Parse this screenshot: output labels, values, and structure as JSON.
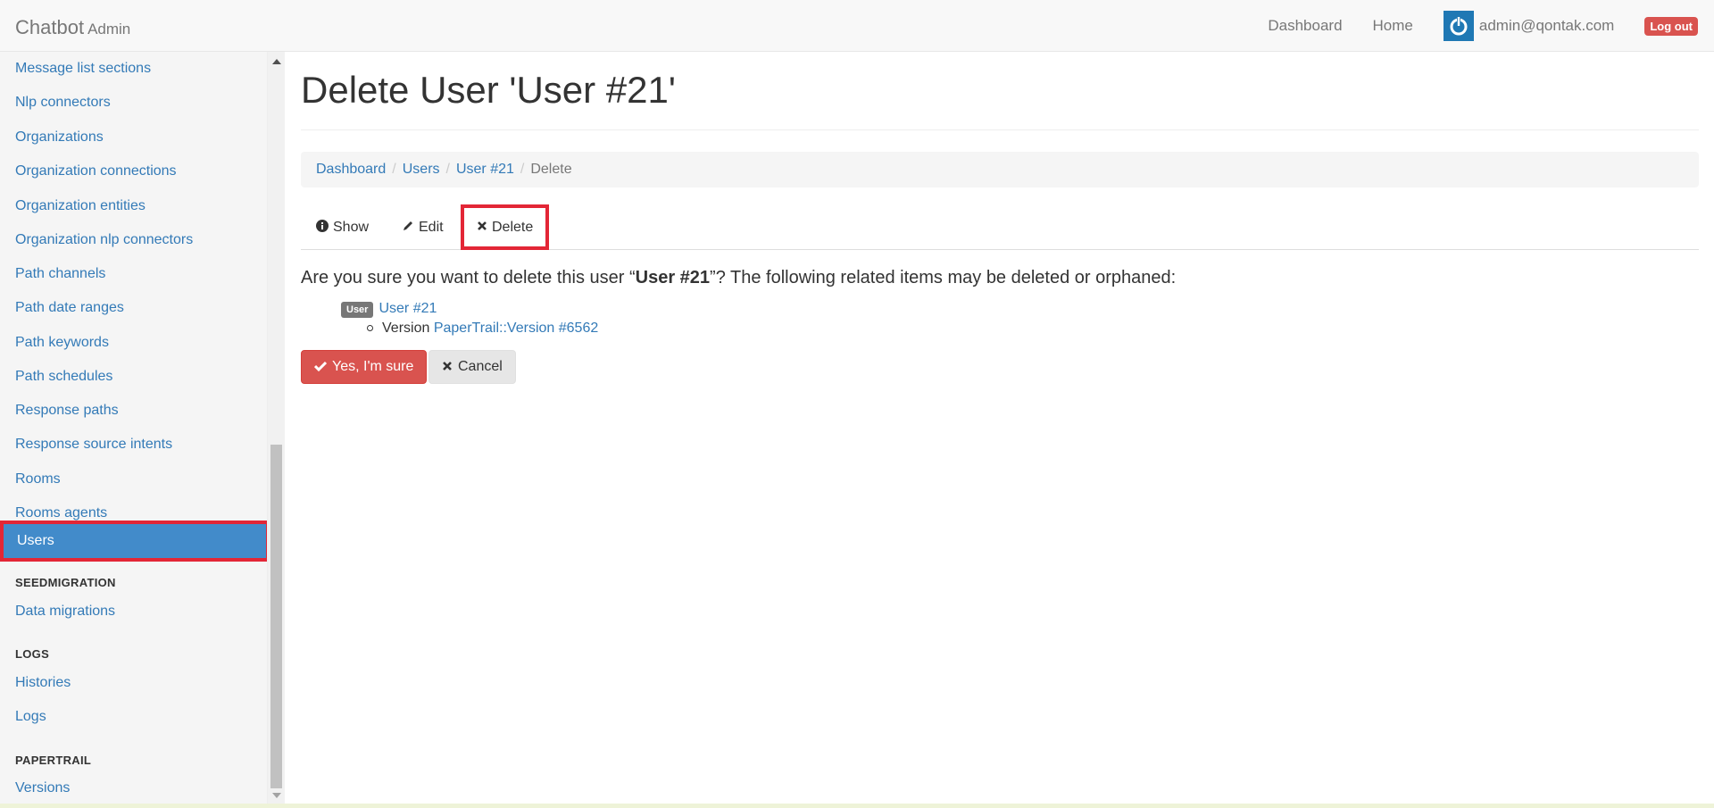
{
  "navbar": {
    "brand": "Chatbot",
    "brand_sub": "Admin",
    "links": [
      "Dashboard",
      "Home"
    ],
    "user_email": "admin@qontak.com",
    "logout_label": "Log out"
  },
  "sidebar": {
    "items": [
      "Message list sections",
      "Nlp connectors",
      "Organizations",
      "Organization connections",
      "Organization entities",
      "Organization nlp connectors",
      "Path channels",
      "Path date ranges",
      "Path keywords",
      "Path schedules",
      "Response paths",
      "Response source intents",
      "Rooms",
      "Rooms agents",
      "Users"
    ],
    "active": "Users",
    "sections": [
      {
        "header": "SEEDMIGRATION",
        "items": [
          "Data migrations"
        ]
      },
      {
        "header": "LOGS",
        "items": [
          "Histories",
          "Logs"
        ]
      },
      {
        "header": "PAPERTRAIL",
        "items": [
          "Versions"
        ]
      }
    ]
  },
  "main": {
    "title": "Delete User 'User #21'",
    "breadcrumb": [
      "Dashboard",
      "Users",
      "User #21",
      "Delete"
    ],
    "tabs": [
      {
        "icon": "info-icon",
        "label": "Show"
      },
      {
        "icon": "pencil-icon",
        "label": "Edit"
      },
      {
        "icon": "times-icon",
        "label": "Delete"
      }
    ],
    "confirm_prefix": "Are you sure you want to delete this user “",
    "confirm_object": "User #21",
    "confirm_suffix": "”? The following related items may be deleted or orphaned:",
    "related_label": "User",
    "related_link": "User #21",
    "version_prefix": "Version",
    "version_link": "PaperTrail::Version #6562",
    "yes_label": "Yes, I'm sure",
    "cancel_label": "Cancel"
  }
}
